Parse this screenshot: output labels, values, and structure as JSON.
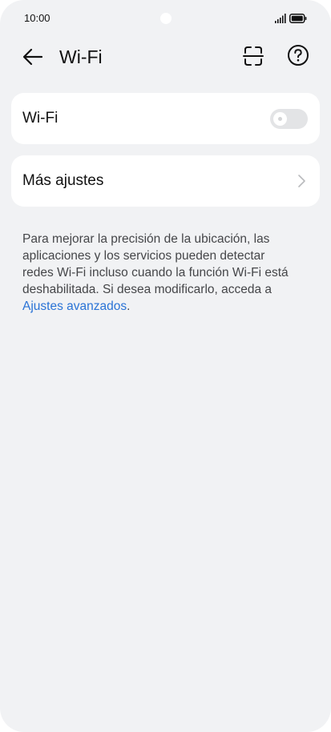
{
  "status_bar": {
    "time": "10:00"
  },
  "header": {
    "title": "Wi-Fi",
    "back_icon": "arrow-left-icon",
    "scan_icon": "scan-icon",
    "help_icon": "help-icon"
  },
  "wifi_card": {
    "label": "Wi-Fi",
    "toggle_state": "off"
  },
  "more_card": {
    "label": "Más ajustes",
    "icon": "chevron-right-icon"
  },
  "info": {
    "text": "Para mejorar la precisión de la ubicación, las aplicaciones y los servicios pueden detectar redes Wi-Fi incluso cuando la función Wi-Fi está deshabilitada. Si desea modificarlo, acceda a ",
    "link_text": "Ajustes avanzados",
    "trailing": "."
  },
  "colors": {
    "background": "#f1f2f4",
    "card": "#ffffff",
    "link": "#2a73d6",
    "toggle_off": "#e3e4e6"
  }
}
